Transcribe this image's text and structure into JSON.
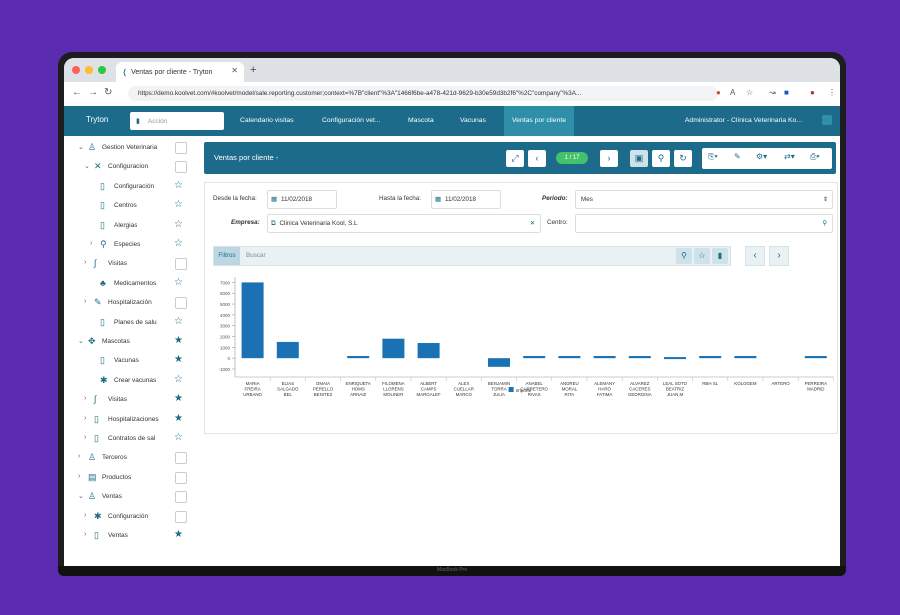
{
  "browser": {
    "tab_title": "Ventas por cliente - Tryton",
    "url": "https://demo.koolvet.com/#koolvet/model/sale.reporting.customer;context=%7B\"client\"%3A\"1466f6be-a478-421d-9629-b30e59d3b2f6\"%2C\"company\"%3A...",
    "bezel_label": "MacBook Pro"
  },
  "app": {
    "brand": "Tryton",
    "search_placeholder": "Acción",
    "menu": [
      "Calendario visitas",
      "Configuración vet...",
      "Mascota",
      "Vacunas",
      "Ventas por cliente"
    ],
    "user": "Administrator - Clínica Veterinaria Ko..."
  },
  "sidebar": {
    "items": [
      {
        "label": "Gestion Veterinaria",
        "icon": "person-icon",
        "state": "box"
      },
      {
        "label": "Configuracion",
        "icon": "tools-icon",
        "state": "box"
      },
      {
        "label": "Configuración",
        "icon": "doc-icon",
        "state": "star-outline"
      },
      {
        "label": "Centros",
        "icon": "doc-icon",
        "state": "star-outline"
      },
      {
        "label": "Alergias",
        "icon": "doc-icon",
        "state": "star-outline"
      },
      {
        "label": "Especies",
        "icon": "search-icon",
        "state": "star-outline"
      },
      {
        "label": "Visitas",
        "icon": "stethoscope-icon",
        "state": "box"
      },
      {
        "label": "Medicamentos",
        "icon": "pills-icon",
        "state": "star-outline"
      },
      {
        "label": "Hospitalización",
        "icon": "edit-icon",
        "state": "box"
      },
      {
        "label": "Planes de salu",
        "icon": "doc-icon",
        "state": "star-outline"
      },
      {
        "label": "Mascotas",
        "icon": "paw-icon",
        "state": "star-filled"
      },
      {
        "label": "Vacunas",
        "icon": "doc-icon",
        "state": "star-filled"
      },
      {
        "label": "Crear vacunas",
        "icon": "gear-icon",
        "state": "star-outline"
      },
      {
        "label": "Visitas",
        "icon": "stethoscope-icon",
        "state": "star-filled"
      },
      {
        "label": "Hospitalizaciones",
        "icon": "doc-icon",
        "state": "star-filled"
      },
      {
        "label": "Contratos de sal",
        "icon": "doc-icon",
        "state": "star-outline"
      },
      {
        "label": "Terceros",
        "icon": "people-icon",
        "state": "box"
      },
      {
        "label": "Productos",
        "icon": "box-icon",
        "state": "box"
      },
      {
        "label": "Ventas",
        "icon": "people-icon",
        "state": "box"
      },
      {
        "label": "Configuración",
        "icon": "gear-icon",
        "state": "box"
      },
      {
        "label": "Ventas",
        "icon": "doc-icon",
        "state": "star-filled"
      }
    ]
  },
  "toolbar": {
    "title": "Ventas por cliente -",
    "pager": "1 / 17"
  },
  "form": {
    "desde_label": "Desde la fecha:",
    "desde_value": "11/02/2018",
    "hasta_label": "Hasta la fecha:",
    "hasta_value": "11/02/2018",
    "periodo_label": "Periodo:",
    "periodo_value": "Mes",
    "empresa_label": "Empresa:",
    "empresa_value": "Clinica Veterinaria Kool, S.L",
    "centro_label": "Centro:",
    "filters_label": "Filtros",
    "search_placeholder": "Buscar"
  },
  "chart_data": {
    "type": "bar",
    "categories": [
      "MARIA FREIRA URBANO",
      "ELIAS SALGADO BEL",
      "OMAIA PERELLO BENITEZ",
      "ENRIQUETA HOMS ARNAIZ",
      "FILOMENA LLORENS MOLINER",
      "ALBERT CAMPS MARGALEF",
      "ALEX CUELLAR MARCO",
      "BENJAMIN TORRA JULIA",
      "ANABEL CARRETERO RIVAS",
      "ANDREU MORAL RITA",
      "ALEMANY HARO FATIMA",
      "ALVAREZ CACERES GEORGINA",
      "LEAL SOTO Beatriz Juan M",
      "RBH SL",
      "KOLOGEM",
      "ARTERO",
      "PERREIRA MADRID"
    ],
    "values": [
      7000,
      1500,
      0,
      200,
      1800,
      1400,
      0,
      -800,
      200,
      200,
      200,
      200,
      100,
      200,
      200,
      0,
      200
    ],
    "ylim": [
      -1000,
      7500
    ],
    "yticks": [
      7000,
      6000,
      5000,
      4000,
      3000,
      2000,
      1000,
      0,
      -1000
    ],
    "legend": [
      "Importe"
    ],
    "colors": {
      "bar": "#1a72b5"
    }
  }
}
